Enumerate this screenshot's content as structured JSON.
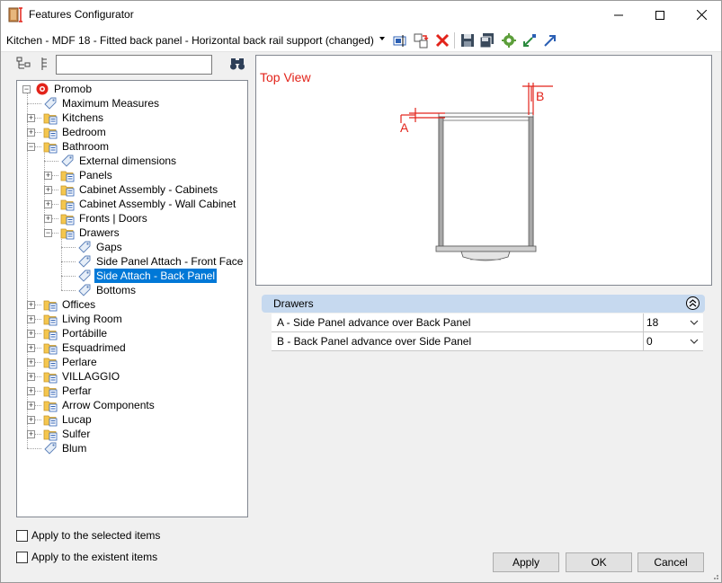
{
  "window": {
    "title": "Features Configurator",
    "controls": {
      "minimize": "minimize-icon",
      "maximize": "maximize-icon",
      "close": "close-icon"
    }
  },
  "toolbar": {
    "config_title": "Kitchen - MDF 18 - Fitted back panel - Horizontal back rail support (changed)",
    "icons": [
      "rename-icon",
      "move-icon",
      "delete-icon",
      "save-icon",
      "save-as-icon",
      "settings-icon",
      "import-icon",
      "export-icon"
    ]
  },
  "search": {
    "value": "",
    "placeholder": ""
  },
  "tree": {
    "items": [
      {
        "label": "Promob",
        "icon": "root-logo-icon"
      },
      {
        "label": "Maximum Measures",
        "icon": "tag-icon"
      },
      {
        "label": "Kitchens",
        "icon": "folder-icon"
      },
      {
        "label": "Bedroom",
        "icon": "folder-icon"
      },
      {
        "label": "Bathroom",
        "icon": "folder-open-icon"
      },
      {
        "label": "External dimensions",
        "icon": "tag-icon"
      },
      {
        "label": "Panels",
        "icon": "folder-icon"
      },
      {
        "label": "Cabinet Assembly - Cabinets",
        "icon": "folder-icon"
      },
      {
        "label": "Cabinet Assembly - Wall Cabinet",
        "icon": "folder-icon"
      },
      {
        "label": "Fronts | Doors",
        "icon": "folder-icon"
      },
      {
        "label": "Drawers",
        "icon": "folder-open-icon"
      },
      {
        "label": "Gaps",
        "icon": "tag-icon"
      },
      {
        "label": "Side Panel Attach - Front Face",
        "icon": "tag-icon"
      },
      {
        "label": "Side Attach - Back Panel",
        "icon": "tag-icon"
      },
      {
        "label": "Bottoms",
        "icon": "tag-icon"
      },
      {
        "label": "Offices",
        "icon": "folder-icon"
      },
      {
        "label": "Living Room",
        "icon": "folder-icon"
      },
      {
        "label": "Portábille",
        "icon": "folder-icon"
      },
      {
        "label": "Esquadrimed",
        "icon": "folder-icon"
      },
      {
        "label": "Perlare",
        "icon": "folder-icon"
      },
      {
        "label": "VILLAGGIO",
        "icon": "folder-icon"
      },
      {
        "label": "Perfar",
        "icon": "folder-icon"
      },
      {
        "label": "Arrow Components",
        "icon": "folder-icon"
      },
      {
        "label": "Lucap",
        "icon": "folder-icon"
      },
      {
        "label": "Sulfer",
        "icon": "folder-icon"
      },
      {
        "label": "Blum",
        "icon": "tag-icon"
      }
    ],
    "selected": "Side Attach - Back Panel"
  },
  "preview": {
    "view_label": "Top View",
    "dim_a": "A",
    "dim_b": "B",
    "accent_color": "#e2231a"
  },
  "properties": {
    "group_title": "Drawers",
    "rows": [
      {
        "label": "A - Side Panel advance over Back Panel",
        "value": "18"
      },
      {
        "label": "B - Back Panel advance over Side Panel",
        "value": "0"
      }
    ]
  },
  "options": {
    "apply_selected": "Apply to the selected items",
    "apply_existent": "Apply to the existent items"
  },
  "buttons": {
    "apply": "Apply",
    "ok": "OK",
    "cancel": "Cancel"
  },
  "colors": {
    "selection": "#0078d7",
    "group_header": "#c6d9ef"
  }
}
